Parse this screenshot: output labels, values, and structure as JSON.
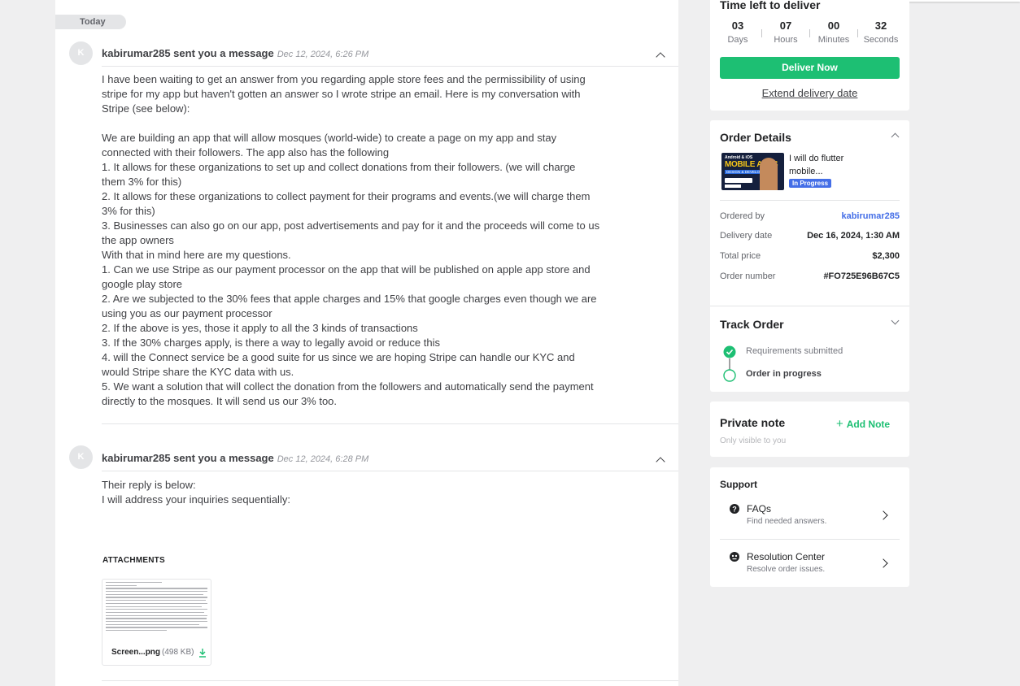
{
  "chat": {
    "today_label": "Today",
    "messages": [
      {
        "avatar_initial": "K",
        "header": "kabirumar285 sent you a message",
        "timestamp": "Dec 12, 2024, 6:26 PM",
        "body": "I have been waiting to get an answer from you regarding apple store fees and the permissibility of using\nstripe for my app but haven't gotten an answer so I wrote stripe an email. Here is my conversation with\nStripe (see below):\n\nWe are building an app that will allow mosques (world-wide) to create a page on my app and stay\nconnected with their followers. The app also has the following\n1. It allows for these organizations to set up and collect donations from their followers. (we will charge\nthem 3% for this)\n2. It allows for these organizations to collect payment for their programs and events.(we will charge them\n3% for this)\n3. Businesses can also go on our app, post advertisements and pay for it and the proceeds will come to us\nthe app owners\nWith that in mind here are my questions.\n1. Can we use Stripe as our payment processor on the app that will be published on apple app store and\ngoogle play store\n2. Are we subjected to the 30% fees that apple charges and 15% that google charges even though we are\nusing you as our payment processor\n2. If the above is yes, those it apply to all the 3 kinds of transactions\n3. If the 30% charges apply, is there a way to legally avoid or reduce this\n4. will the Connect service be a good suite for us since we are hoping Stripe can handle our KYC and\nwould Stripe share the KYC data with us.\n5. We want a solution that will collect the donation from the followers and automatically send the payment\ndirectly to the mosques. It will send us our 3% too."
      },
      {
        "avatar_initial": "K",
        "header": "kabirumar285 sent you a message",
        "timestamp": "Dec 12, 2024, 6:28 PM",
        "body": "Their reply is below:\nI will address your inquiries sequentially:"
      }
    ],
    "attachments_title": "ATTACHMENTS",
    "attachment": {
      "name": "Screen...png",
      "size": "(498 KB)"
    }
  },
  "delivery": {
    "title": "Time left to deliver",
    "countdown": [
      {
        "value": "03",
        "label": "Days"
      },
      {
        "value": "07",
        "label": "Hours"
      },
      {
        "value": "00",
        "label": "Minutes"
      },
      {
        "value": "32",
        "label": "Seconds"
      }
    ],
    "deliver_button": "Deliver Now",
    "extend_link": "Extend delivery date"
  },
  "order_details": {
    "title": "Order Details",
    "gig_title": "I will do flutter mobile...",
    "gig_image": {
      "line1": "Android & iOS",
      "line2": "MOBILE APPS",
      "line3": "DESIGN & DEVELOPMENT"
    },
    "status_badge": "In Progress",
    "rows": [
      {
        "label": "Ordered by",
        "value": "kabirumar285"
      },
      {
        "label": "Delivery date",
        "value": "Dec 16, 2024, 1:30 AM"
      },
      {
        "label": "Total price",
        "value": "$2,300"
      },
      {
        "label": "Order number",
        "value": "#FO725E96B67C5"
      }
    ]
  },
  "track_order": {
    "title": "Track Order",
    "steps": [
      {
        "label": "Requirements submitted",
        "done": true
      },
      {
        "label": "Order in progress",
        "done": false
      }
    ]
  },
  "private_note": {
    "title": "Private note",
    "add_label": "Add Note",
    "subtitle": "Only visible to you"
  },
  "support": {
    "title": "Support",
    "items": [
      {
        "title": "FAQs",
        "subtitle": "Find needed answers.",
        "icon": "question-icon"
      },
      {
        "title": "Resolution Center",
        "subtitle": "Resolve order issues.",
        "icon": "resolution-icon"
      }
    ]
  },
  "colors": {
    "accent_green": "#1dbf73",
    "link_blue": "#446ee7",
    "page_bg": "#efeff0"
  }
}
